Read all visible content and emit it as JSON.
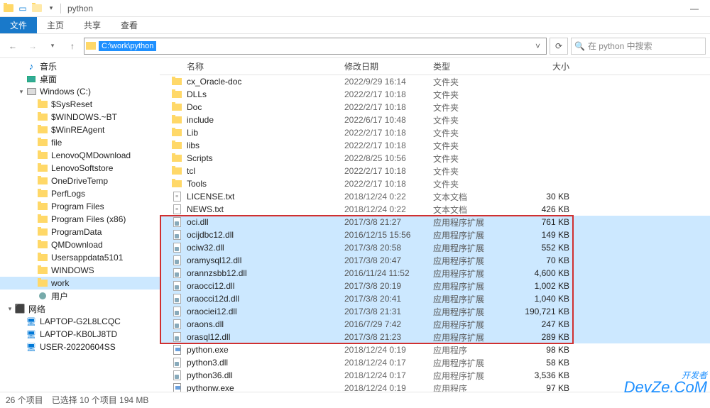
{
  "title": "python",
  "ribbon": {
    "file": "文件",
    "home": "主页",
    "share": "共享",
    "view": "查看"
  },
  "path_text": "C:\\work\\python",
  "search_placeholder": "在 python 中搜索",
  "nav": [
    {
      "indent": 1,
      "icon": "music",
      "label": "音乐",
      "exp": ""
    },
    {
      "indent": 1,
      "icon": "desktop",
      "label": "桌面",
      "exp": ""
    },
    {
      "indent": 1,
      "icon": "disk",
      "label": "Windows (C:)",
      "exp": "▾"
    },
    {
      "indent": 2,
      "icon": "folder",
      "label": "$SysReset",
      "exp": ""
    },
    {
      "indent": 2,
      "icon": "folder",
      "label": "$WINDOWS.~BT",
      "exp": ""
    },
    {
      "indent": 2,
      "icon": "folder",
      "label": "$WinREAgent",
      "exp": ""
    },
    {
      "indent": 2,
      "icon": "folder",
      "label": "file",
      "exp": ""
    },
    {
      "indent": 2,
      "icon": "folder",
      "label": "LenovoQMDownload",
      "exp": ""
    },
    {
      "indent": 2,
      "icon": "folder",
      "label": "LenovoSoftstore",
      "exp": ""
    },
    {
      "indent": 2,
      "icon": "folder",
      "label": "OneDriveTemp",
      "exp": ""
    },
    {
      "indent": 2,
      "icon": "folder",
      "label": "PerfLogs",
      "exp": ""
    },
    {
      "indent": 2,
      "icon": "folder",
      "label": "Program Files",
      "exp": ""
    },
    {
      "indent": 2,
      "icon": "folder",
      "label": "Program Files (x86)",
      "exp": ""
    },
    {
      "indent": 2,
      "icon": "folder",
      "label": "ProgramData",
      "exp": ""
    },
    {
      "indent": 2,
      "icon": "folder",
      "label": "QMDownload",
      "exp": ""
    },
    {
      "indent": 2,
      "icon": "folder",
      "label": "Usersappdata5101",
      "exp": ""
    },
    {
      "indent": 2,
      "icon": "folder",
      "label": "WINDOWS",
      "exp": ""
    },
    {
      "indent": 2,
      "icon": "folder",
      "label": "work",
      "exp": "",
      "sel": true
    },
    {
      "indent": 2,
      "icon": "user",
      "label": "用户",
      "exp": ""
    },
    {
      "indent": 0,
      "icon": "net",
      "label": "网络",
      "exp": "▾"
    },
    {
      "indent": 1,
      "icon": "pc",
      "label": "LAPTOP-G2L8LCQC",
      "exp": ""
    },
    {
      "indent": 1,
      "icon": "pc",
      "label": "LAPTOP-KB0LJ8TD",
      "exp": ""
    },
    {
      "indent": 1,
      "icon": "pc",
      "label": "USER-20220604SS",
      "exp": ""
    }
  ],
  "cols": {
    "name": "名称",
    "date": "修改日期",
    "type": "类型",
    "size": "大小"
  },
  "files": [
    {
      "icon": "folder",
      "name": "cx_Oracle-doc",
      "date": "2022/9/29 16:14",
      "type": "文件夹",
      "size": ""
    },
    {
      "icon": "folder",
      "name": "DLLs",
      "date": "2022/2/17 10:18",
      "type": "文件夹",
      "size": ""
    },
    {
      "icon": "folder",
      "name": "Doc",
      "date": "2022/2/17 10:18",
      "type": "文件夹",
      "size": ""
    },
    {
      "icon": "folder",
      "name": "include",
      "date": "2022/6/17 10:48",
      "type": "文件夹",
      "size": ""
    },
    {
      "icon": "folder",
      "name": "Lib",
      "date": "2022/2/17 10:18",
      "type": "文件夹",
      "size": ""
    },
    {
      "icon": "folder",
      "name": "libs",
      "date": "2022/2/17 10:18",
      "type": "文件夹",
      "size": ""
    },
    {
      "icon": "folder",
      "name": "Scripts",
      "date": "2022/8/25 10:56",
      "type": "文件夹",
      "size": ""
    },
    {
      "icon": "folder",
      "name": "tcl",
      "date": "2022/2/17 10:18",
      "type": "文件夹",
      "size": ""
    },
    {
      "icon": "folder",
      "name": "Tools",
      "date": "2022/2/17 10:18",
      "type": "文件夹",
      "size": ""
    },
    {
      "icon": "txt",
      "name": "LICENSE.txt",
      "date": "2018/12/24 0:22",
      "type": "文本文档",
      "size": "30 KB"
    },
    {
      "icon": "txt",
      "name": "NEWS.txt",
      "date": "2018/12/24 0:22",
      "type": "文本文档",
      "size": "426 KB"
    },
    {
      "icon": "dll",
      "name": "oci.dll",
      "date": "2017/3/8 21:27",
      "type": "应用程序扩展",
      "size": "761 KB",
      "sel": true
    },
    {
      "icon": "dll",
      "name": "ocijdbc12.dll",
      "date": "2016/12/15 15:56",
      "type": "应用程序扩展",
      "size": "149 KB",
      "sel": true
    },
    {
      "icon": "dll",
      "name": "ociw32.dll",
      "date": "2017/3/8 20:58",
      "type": "应用程序扩展",
      "size": "552 KB",
      "sel": true
    },
    {
      "icon": "dll",
      "name": "oramysql12.dll",
      "date": "2017/3/8 20:47",
      "type": "应用程序扩展",
      "size": "70 KB",
      "sel": true
    },
    {
      "icon": "dll",
      "name": "orannzsbb12.dll",
      "date": "2016/11/24 11:52",
      "type": "应用程序扩展",
      "size": "4,600 KB",
      "sel": true
    },
    {
      "icon": "dll",
      "name": "oraocci12.dll",
      "date": "2017/3/8 20:19",
      "type": "应用程序扩展",
      "size": "1,002 KB",
      "sel": true
    },
    {
      "icon": "dll",
      "name": "oraocci12d.dll",
      "date": "2017/3/8 20:41",
      "type": "应用程序扩展",
      "size": "1,040 KB",
      "sel": true
    },
    {
      "icon": "dll",
      "name": "oraociei12.dll",
      "date": "2017/3/8 21:31",
      "type": "应用程序扩展",
      "size": "190,721 KB",
      "sel": true
    },
    {
      "icon": "dll",
      "name": "oraons.dll",
      "date": "2016/7/29 7:42",
      "type": "应用程序扩展",
      "size": "247 KB",
      "sel": true
    },
    {
      "icon": "dll",
      "name": "orasql12.dll",
      "date": "2017/3/8 21:23",
      "type": "应用程序扩展",
      "size": "289 KB",
      "sel": true
    },
    {
      "icon": "exe",
      "name": "python.exe",
      "date": "2018/12/24 0:19",
      "type": "应用程序",
      "size": "98 KB"
    },
    {
      "icon": "dll",
      "name": "python3.dll",
      "date": "2018/12/24 0:17",
      "type": "应用程序扩展",
      "size": "58 KB"
    },
    {
      "icon": "dll",
      "name": "python36.dll",
      "date": "2018/12/24 0:17",
      "type": "应用程序扩展",
      "size": "3,536 KB"
    },
    {
      "icon": "exe",
      "name": "pythonw.exe",
      "date": "2018/12/24 0:19",
      "type": "应用程序",
      "size": "97 KB"
    }
  ],
  "status": {
    "count": "26 个项目",
    "selected": "已选择 10 个项目  194 MB"
  },
  "watermark": {
    "l1": "开发者",
    "l2": "DevZe.CoM"
  }
}
